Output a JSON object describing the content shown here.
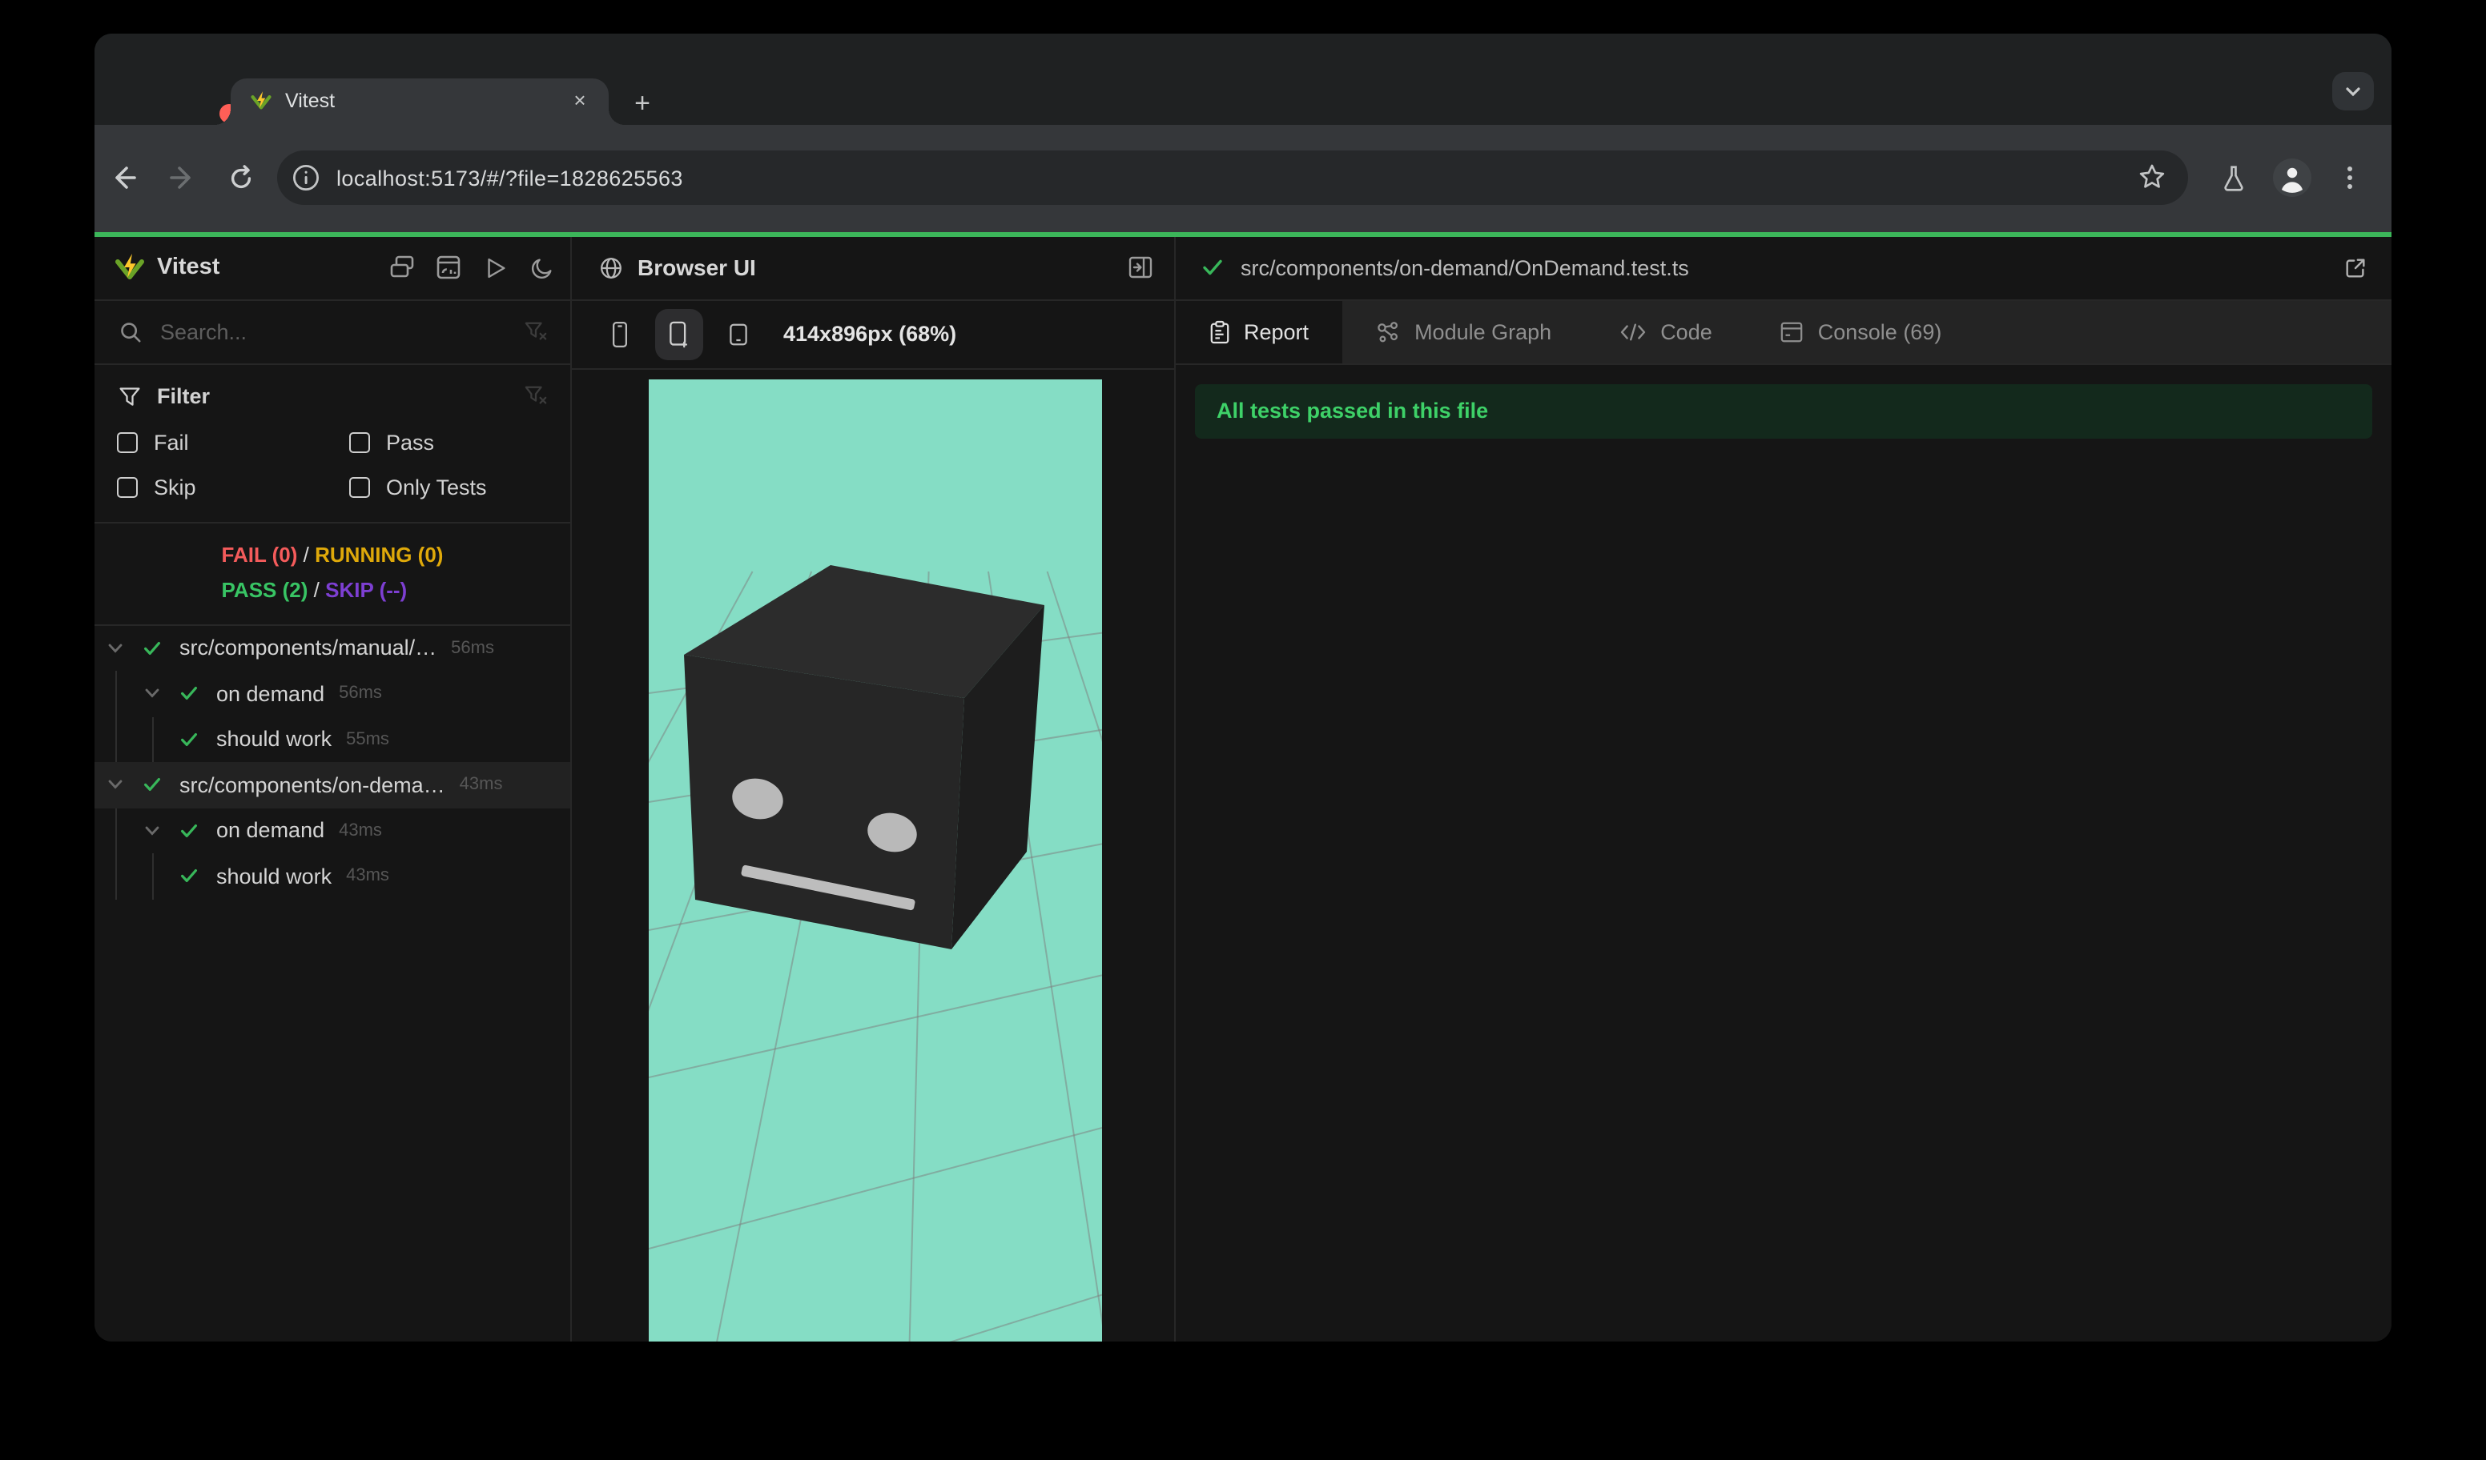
{
  "browser": {
    "tab_title": "Vitest",
    "close_glyph": "×",
    "new_tab_glyph": "+",
    "url": "localhost:5173/#/?file=1828625563"
  },
  "sidebar": {
    "brand": "Vitest",
    "search_placeholder": "Search...",
    "filter": {
      "title": "Filter",
      "options": [
        {
          "label": "Fail",
          "checked": false
        },
        {
          "label": "Pass",
          "checked": false
        },
        {
          "label": "Skip",
          "checked": false
        },
        {
          "label": "Only Tests",
          "checked": false
        }
      ]
    },
    "dashboard": {
      "fail": "FAIL (0)",
      "slash": "/",
      "running": "RUNNING (0)",
      "pass": "PASS (2)",
      "skip": "SKIP (--)"
    },
    "tree": [
      {
        "label": "src/components/manual/…",
        "duration": "56ms",
        "level": "file",
        "status": "pass"
      },
      {
        "label": "on demand",
        "duration": "56ms",
        "level": "suite",
        "status": "pass"
      },
      {
        "label": "should work",
        "duration": "55ms",
        "level": "test",
        "status": "pass"
      },
      {
        "label": "src/components/on-dema…",
        "duration": "43ms",
        "level": "file",
        "status": "pass",
        "selected": true
      },
      {
        "label": "on demand",
        "duration": "43ms",
        "level": "suite",
        "status": "pass"
      },
      {
        "label": "should work",
        "duration": "43ms",
        "level": "test",
        "status": "pass"
      }
    ]
  },
  "preview": {
    "title": "Browser UI",
    "viewport": "414x896px (68%)"
  },
  "report": {
    "path": "src/components/on-demand/OnDemand.test.ts",
    "tabs": [
      {
        "label": "Report",
        "active": true
      },
      {
        "label": "Module Graph",
        "active": false
      },
      {
        "label": "Code",
        "active": false
      },
      {
        "label": "Console (69)",
        "active": false
      }
    ],
    "banner": "All tests passed in this file"
  },
  "colors": {
    "progress_green": "#3cb65a",
    "pass_green": "#38c464",
    "fail_red": "#f45b5b",
    "running_yellow": "#dfa90a",
    "skip_purple": "#7d3fd2",
    "banner_bg": "#13291c",
    "banner_text": "#3ed168",
    "preview_mint": "#85ddc5",
    "panel_bg": "#151515",
    "chrome_toolbar": "#35373a",
    "traffic_red": "#ff5f57",
    "traffic_yellow": "#febc2e",
    "traffic_green": "#28c840"
  }
}
